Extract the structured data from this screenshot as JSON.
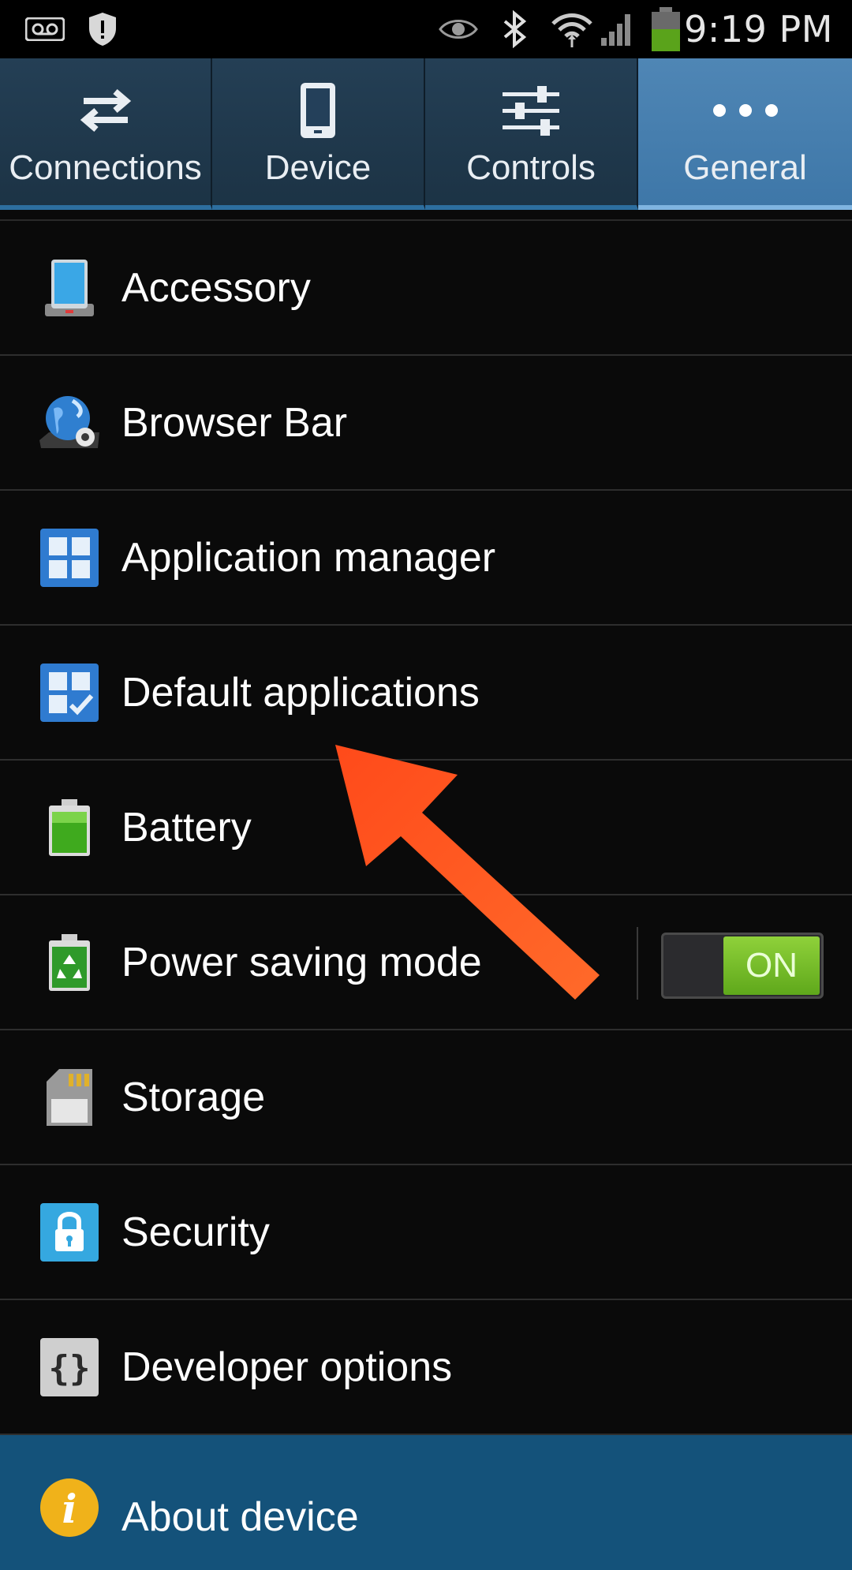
{
  "status_bar": {
    "time": "9:19 PM",
    "icons": [
      "voicemail-icon",
      "shield-icon",
      "eye-icon",
      "bluetooth-icon",
      "wifi-icon",
      "signal-icon",
      "battery-icon"
    ]
  },
  "tabs": [
    {
      "label": "Connections",
      "icon": "arrows-swap-icon",
      "active": false
    },
    {
      "label": "Device",
      "icon": "phone-icon",
      "active": false
    },
    {
      "label": "Controls",
      "icon": "sliders-icon",
      "active": false
    },
    {
      "label": "General",
      "icon": "more-dots-icon",
      "active": true
    }
  ],
  "settings": [
    {
      "label": "Accessory",
      "icon": "accessory-icon"
    },
    {
      "label": "Browser Bar",
      "icon": "globe-gear-icon"
    },
    {
      "label": "Application manager",
      "icon": "app-grid-icon"
    },
    {
      "label": "Default applications",
      "icon": "app-grid-check-icon"
    },
    {
      "label": "Battery",
      "icon": "battery-icon"
    },
    {
      "label": "Power saving mode",
      "icon": "battery-recycle-icon",
      "toggle": {
        "label": "ON",
        "on": true
      }
    },
    {
      "label": "Storage",
      "icon": "sd-card-icon"
    },
    {
      "label": "Security",
      "icon": "lock-icon"
    },
    {
      "label": "Developer options",
      "icon": "braces-icon"
    },
    {
      "label": "About device",
      "icon": "info-icon"
    }
  ],
  "colors": {
    "active_tab": "#4a80b0",
    "toggle_on": "#6fbb22",
    "annotation_arrow": "#ff5a1f",
    "about_row": "#14527a"
  }
}
